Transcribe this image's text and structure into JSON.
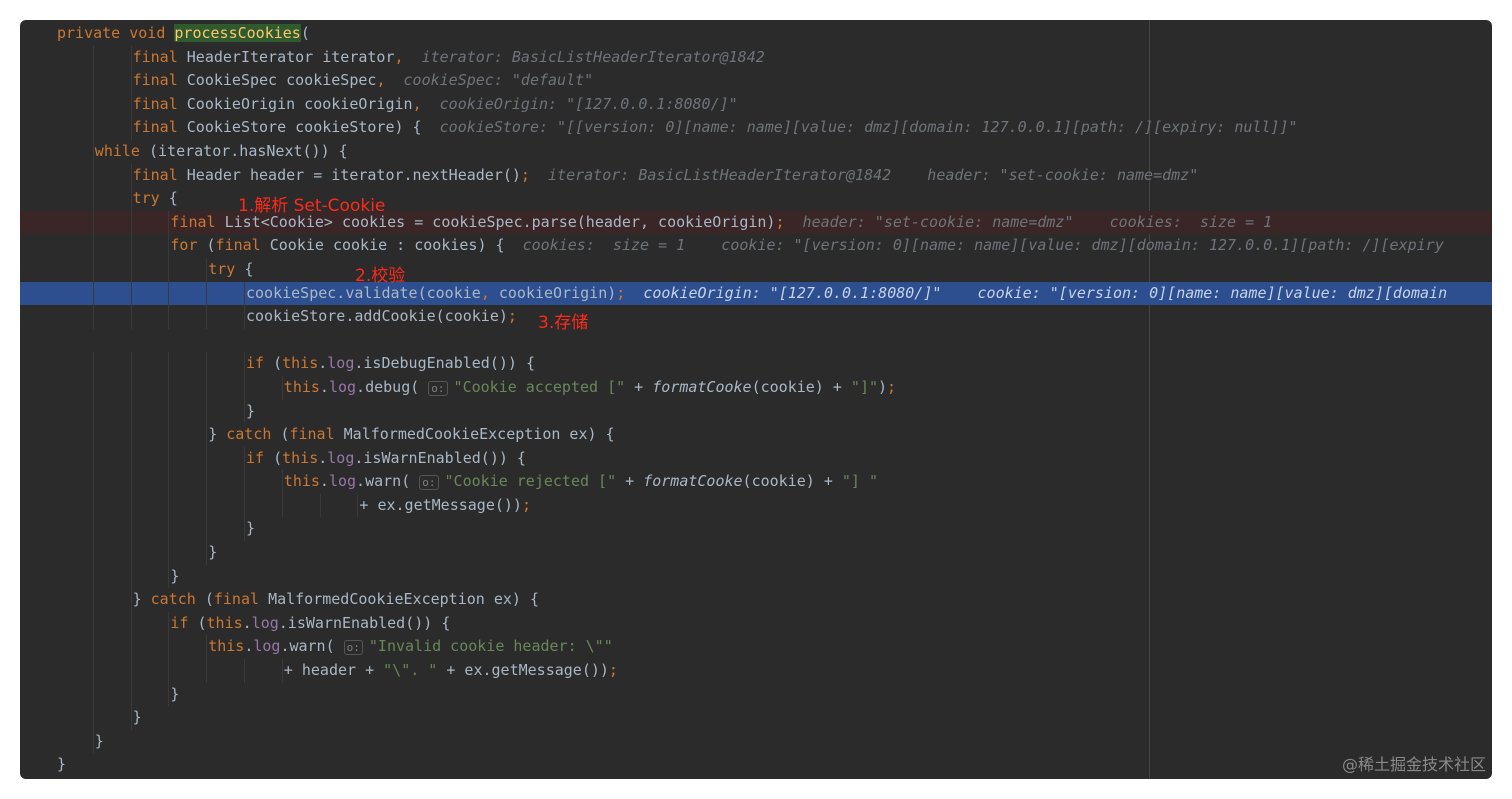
{
  "editor": {
    "lines": [
      {
        "indent": 1,
        "hl": "",
        "tokens": [
          {
            "c": "kw",
            "t": "private void "
          },
          {
            "c": "fn-hl",
            "t": "processCookies"
          },
          {
            "c": "",
            "t": "("
          }
        ]
      },
      {
        "indent": 3,
        "hl": "",
        "tokens": [
          {
            "c": "kw",
            "t": "final "
          },
          {
            "c": "",
            "t": "HeaderIterator iterator"
          },
          {
            "c": "kw",
            "t": ","
          },
          {
            "c": "hint",
            "t": "  iterator: BasicListHeaderIterator@1842"
          }
        ]
      },
      {
        "indent": 3,
        "hl": "",
        "tokens": [
          {
            "c": "kw",
            "t": "final "
          },
          {
            "c": "",
            "t": "CookieSpec cookieSpec"
          },
          {
            "c": "kw",
            "t": ","
          },
          {
            "c": "hint",
            "t": "  cookieSpec: \"default\""
          }
        ]
      },
      {
        "indent": 3,
        "hl": "",
        "tokens": [
          {
            "c": "kw",
            "t": "final "
          },
          {
            "c": "",
            "t": "CookieOrigin cookieOrigin"
          },
          {
            "c": "kw",
            "t": ","
          },
          {
            "c": "hint",
            "t": "  cookieOrigin: \"[127.0.0.1:8080/]\""
          }
        ]
      },
      {
        "indent": 3,
        "hl": "",
        "tokens": [
          {
            "c": "kw",
            "t": "final "
          },
          {
            "c": "",
            "t": "CookieStore cookieStore) {"
          },
          {
            "c": "hint",
            "t": "  cookieStore: \"[[version: 0][name: name][value: dmz][domain: 127.0.0.1][path: /][expiry: null]]\""
          }
        ]
      },
      {
        "indent": 2,
        "hl": "",
        "tokens": [
          {
            "c": "kw",
            "t": "while "
          },
          {
            "c": "",
            "t": "(iterator.hasNext()) {"
          }
        ]
      },
      {
        "indent": 3,
        "hl": "",
        "tokens": [
          {
            "c": "kw",
            "t": "final "
          },
          {
            "c": "",
            "t": "Header header = iterator.nextHeader()"
          },
          {
            "c": "kw",
            "t": ";"
          },
          {
            "c": "hint",
            "t": "  iterator: BasicListHeaderIterator@1842    header: \"set-cookie: name=dmz\""
          }
        ]
      },
      {
        "indent": 3,
        "hl": "",
        "tokens": [
          {
            "c": "kw",
            "t": "try "
          },
          {
            "c": "",
            "t": "{"
          }
        ]
      },
      {
        "indent": 4,
        "hl": "red",
        "tokens": [
          {
            "c": "kw",
            "t": "final "
          },
          {
            "c": "",
            "t": "List<Cookie> cookies = cookieSpec.parse(header, cookieOrigin)"
          },
          {
            "c": "kw",
            "t": ";"
          },
          {
            "c": "hint",
            "t": "  header: \"set-cookie: name=dmz\"    cookies:  size = 1"
          }
        ]
      },
      {
        "indent": 4,
        "hl": "",
        "tokens": [
          {
            "c": "kw",
            "t": "for "
          },
          {
            "c": "",
            "t": "("
          },
          {
            "c": "kw",
            "t": "final "
          },
          {
            "c": "",
            "t": "Cookie cookie : cookies) {"
          },
          {
            "c": "hint",
            "t": "  cookies:  size = 1    cookie: \"[version: 0][name: name][value: dmz][domain: 127.0.0.1][path: /][expiry"
          }
        ]
      },
      {
        "indent": 5,
        "hl": "",
        "tokens": [
          {
            "c": "kw",
            "t": "try "
          },
          {
            "c": "",
            "t": "{"
          }
        ]
      },
      {
        "indent": 6,
        "hl": "blue",
        "tokens": [
          {
            "c": "",
            "t": "cookieSpec.validate(cookie"
          },
          {
            "c": "kw",
            "t": ", "
          },
          {
            "c": "",
            "t": "cookieOrigin)"
          },
          {
            "c": "kw",
            "t": ";"
          },
          {
            "c": "hint",
            "t": "  cookieOrigin: \"[127.0.0.1:8080/]\"    cookie: \"[version: 0][name: name][value: dmz][domain"
          }
        ]
      },
      {
        "indent": 6,
        "hl": "",
        "tokens": [
          {
            "c": "",
            "t": "cookieStore.addCookie(cookie)"
          },
          {
            "c": "kw",
            "t": ";"
          }
        ]
      },
      {
        "indent": 0,
        "hl": "",
        "tokens": []
      },
      {
        "indent": 6,
        "hl": "",
        "tokens": [
          {
            "c": "kw",
            "t": "if "
          },
          {
            "c": "",
            "t": "("
          },
          {
            "c": "kw",
            "t": "this"
          },
          {
            "c": "",
            "t": "."
          },
          {
            "c": "field",
            "t": "log"
          },
          {
            "c": "",
            "t": ".isDebugEnabled()) {"
          }
        ]
      },
      {
        "indent": 7,
        "hl": "",
        "tokens": [
          {
            "c": "kw",
            "t": "this"
          },
          {
            "c": "",
            "t": "."
          },
          {
            "c": "field",
            "t": "log"
          },
          {
            "c": "",
            "t": ".debug( "
          },
          {
            "c": "ph",
            "t": "o:"
          },
          {
            "c": "str",
            "t": "\"Cookie accepted [\""
          },
          {
            "c": "",
            "t": " + "
          },
          {
            "c": "it",
            "t": "formatCooke"
          },
          {
            "c": "",
            "t": "(cookie) + "
          },
          {
            "c": "str",
            "t": "\"]\""
          },
          {
            "c": "",
            "t": ")"
          },
          {
            "c": "kw",
            "t": ";"
          }
        ]
      },
      {
        "indent": 6,
        "hl": "",
        "tokens": [
          {
            "c": "",
            "t": "}"
          }
        ]
      },
      {
        "indent": 5,
        "hl": "",
        "tokens": [
          {
            "c": "",
            "t": "} "
          },
          {
            "c": "kw",
            "t": "catch "
          },
          {
            "c": "",
            "t": "("
          },
          {
            "c": "kw",
            "t": "final "
          },
          {
            "c": "",
            "t": "MalformedCookieException ex) {"
          }
        ]
      },
      {
        "indent": 6,
        "hl": "",
        "tokens": [
          {
            "c": "kw",
            "t": "if "
          },
          {
            "c": "",
            "t": "("
          },
          {
            "c": "kw",
            "t": "this"
          },
          {
            "c": "",
            "t": "."
          },
          {
            "c": "field",
            "t": "log"
          },
          {
            "c": "",
            "t": ".isWarnEnabled()) {"
          }
        ]
      },
      {
        "indent": 7,
        "hl": "",
        "tokens": [
          {
            "c": "kw",
            "t": "this"
          },
          {
            "c": "",
            "t": "."
          },
          {
            "c": "field",
            "t": "log"
          },
          {
            "c": "",
            "t": ".warn( "
          },
          {
            "c": "ph",
            "t": "o:"
          },
          {
            "c": "str",
            "t": "\"Cookie rejected [\""
          },
          {
            "c": "",
            "t": " + "
          },
          {
            "c": "it",
            "t": "formatCooke"
          },
          {
            "c": "",
            "t": "(cookie) + "
          },
          {
            "c": "str",
            "t": "\"] \""
          }
        ]
      },
      {
        "indent": 9,
        "hl": "",
        "tokens": [
          {
            "c": "",
            "t": "+ ex.getMessage())"
          },
          {
            "c": "kw",
            "t": ";"
          }
        ]
      },
      {
        "indent": 6,
        "hl": "",
        "tokens": [
          {
            "c": "",
            "t": "}"
          }
        ]
      },
      {
        "indent": 5,
        "hl": "",
        "tokens": [
          {
            "c": "",
            "t": "}"
          }
        ]
      },
      {
        "indent": 4,
        "hl": "",
        "tokens": [
          {
            "c": "",
            "t": "}"
          }
        ]
      },
      {
        "indent": 3,
        "hl": "",
        "tokens": [
          {
            "c": "",
            "t": "} "
          },
          {
            "c": "kw",
            "t": "catch "
          },
          {
            "c": "",
            "t": "("
          },
          {
            "c": "kw",
            "t": "final "
          },
          {
            "c": "",
            "t": "MalformedCookieException ex) {"
          }
        ]
      },
      {
        "indent": 4,
        "hl": "",
        "tokens": [
          {
            "c": "kw",
            "t": "if "
          },
          {
            "c": "",
            "t": "("
          },
          {
            "c": "kw",
            "t": "this"
          },
          {
            "c": "",
            "t": "."
          },
          {
            "c": "field",
            "t": "log"
          },
          {
            "c": "",
            "t": ".isWarnEnabled()) {"
          }
        ]
      },
      {
        "indent": 5,
        "hl": "",
        "tokens": [
          {
            "c": "kw",
            "t": "this"
          },
          {
            "c": "",
            "t": "."
          },
          {
            "c": "field",
            "t": "log"
          },
          {
            "c": "",
            "t": ".warn( "
          },
          {
            "c": "ph",
            "t": "o:"
          },
          {
            "c": "str",
            "t": "\"Invalid cookie header: \\\"\""
          }
        ]
      },
      {
        "indent": 7,
        "hl": "",
        "tokens": [
          {
            "c": "",
            "t": "+ header + "
          },
          {
            "c": "str",
            "t": "\"\\\". \""
          },
          {
            "c": "",
            "t": " + ex.getMessage())"
          },
          {
            "c": "kw",
            "t": ";"
          }
        ]
      },
      {
        "indent": 4,
        "hl": "",
        "tokens": [
          {
            "c": "",
            "t": "}"
          }
        ]
      },
      {
        "indent": 3,
        "hl": "",
        "tokens": [
          {
            "c": "",
            "t": "}"
          }
        ]
      },
      {
        "indent": 2,
        "hl": "",
        "tokens": [
          {
            "c": "",
            "t": "}"
          }
        ]
      },
      {
        "indent": 1,
        "hl": "",
        "tokens": [
          {
            "c": "",
            "t": "}"
          }
        ]
      }
    ]
  },
  "annotations": {
    "step1": "1.解析 Set-Cookie",
    "step2": "2.校验",
    "step3": "3.存储"
  },
  "watermark": "@稀土掘金技术社区",
  "colors": {
    "background": "#2b2b2b",
    "keyword": "#cc7832",
    "method": "#ffc66d",
    "field": "#9876aa",
    "string": "#6a8759",
    "text": "#a9b7c6",
    "hint": "#6f737a",
    "annotation": "#ff2a1a",
    "exec_line": "#2d4f8f",
    "breakpoint_line": "#3a2626"
  }
}
